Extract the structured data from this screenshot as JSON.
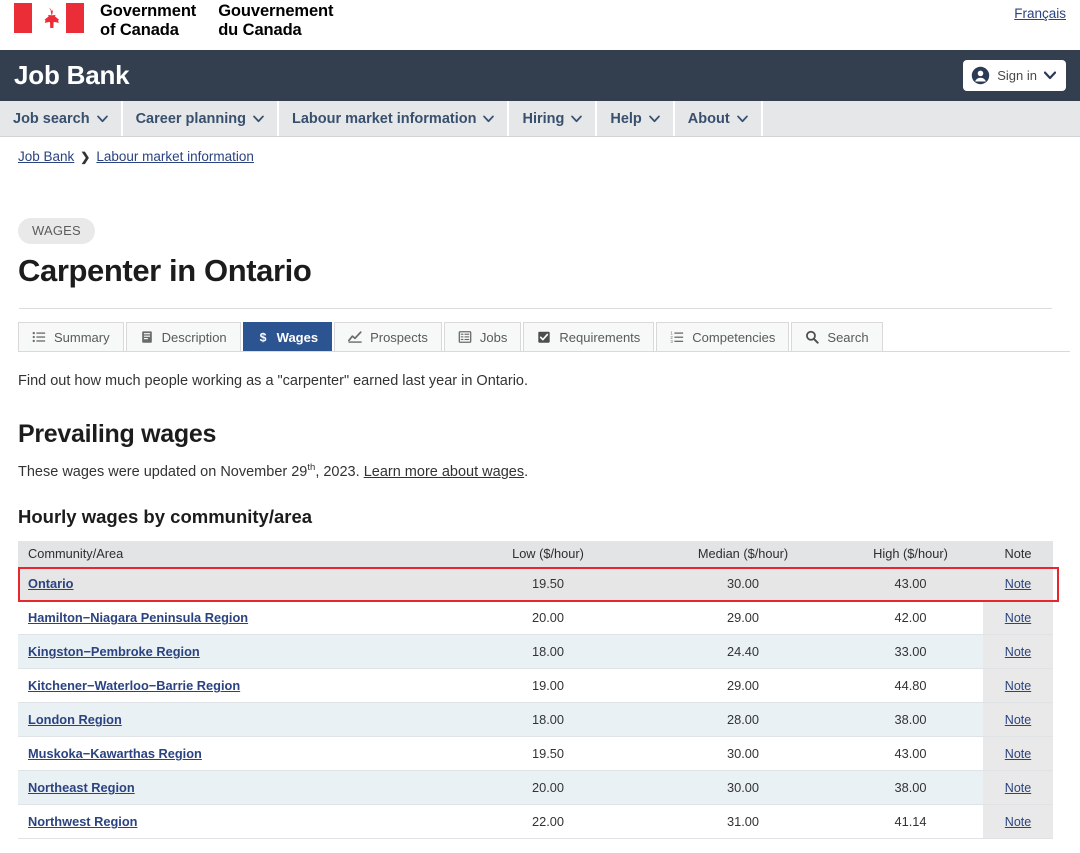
{
  "goc_header": {
    "flag_alt": "canada-flag",
    "wordmark_en_line1": "Government",
    "wordmark_en_line2": "of Canada",
    "wordmark_fr_line1": "Gouvernement",
    "wordmark_fr_line2": "du Canada",
    "language_toggle": "Français"
  },
  "app_bar": {
    "title": "Job Bank",
    "signin_label": "Sign in"
  },
  "main_nav": {
    "items": [
      {
        "label": "Job search",
        "has_caret": true
      },
      {
        "label": "Career planning",
        "has_caret": true
      },
      {
        "label": "Labour market information",
        "has_caret": true
      },
      {
        "label": "Hiring",
        "has_caret": true
      },
      {
        "label": "Help",
        "has_caret": true
      },
      {
        "label": "About",
        "has_caret": true
      }
    ]
  },
  "breadcrumb": {
    "items": [
      "Job Bank",
      "Labour market information"
    ],
    "separator": "❯"
  },
  "page": {
    "badge": "WAGES",
    "title": "Carpenter in Ontario",
    "intro": "Find out how much people working as a \"carpenter\" earned last year in Ontario.",
    "section_heading": "Prevailing wages",
    "updated_prefix": "These wages were updated on November 29",
    "updated_sup": "th",
    "updated_suffix": ", 2023. ",
    "updated_link": "Learn more about wages",
    "updated_period": ".",
    "subsection_heading": "Hourly wages by community/area"
  },
  "tabs": [
    {
      "label": "Summary",
      "icon": "list-icon",
      "active": false
    },
    {
      "label": "Description",
      "icon": "book-icon",
      "active": false
    },
    {
      "label": "Wages",
      "icon": "dollar-icon",
      "active": true
    },
    {
      "label": "Prospects",
      "icon": "chart-line-icon",
      "active": false
    },
    {
      "label": "Jobs",
      "icon": "table-icon",
      "active": false
    },
    {
      "label": "Requirements",
      "icon": "checkbox-icon",
      "active": false
    },
    {
      "label": "Competencies",
      "icon": "ordered-list-icon",
      "active": false
    },
    {
      "label": "Search",
      "icon": "search-icon",
      "active": false
    }
  ],
  "wages_table": {
    "columns": [
      "Community/Area",
      "Low ($/hour)",
      "Median ($/hour)",
      "High ($/hour)",
      "Note"
    ],
    "note_label": "Note",
    "rows": [
      {
        "area": "Ontario",
        "low": "19.50",
        "median": "30.00",
        "high": "43.00",
        "note": "Note",
        "highlighted": true
      },
      {
        "area": "Hamilton−Niagara Peninsula Region",
        "low": "20.00",
        "median": "29.00",
        "high": "42.00",
        "note": "Note",
        "highlighted": false
      },
      {
        "area": "Kingston−Pembroke Region",
        "low": "18.00",
        "median": "24.40",
        "high": "33.00",
        "note": "Note",
        "highlighted": false
      },
      {
        "area": "Kitchener−Waterloo−Barrie Region",
        "low": "19.00",
        "median": "29.00",
        "high": "44.80",
        "note": "Note",
        "highlighted": false
      },
      {
        "area": "London Region",
        "low": "18.00",
        "median": "28.00",
        "high": "38.00",
        "note": "Note",
        "highlighted": false
      },
      {
        "area": "Muskoka−Kawarthas Region",
        "low": "19.50",
        "median": "30.00",
        "high": "43.00",
        "note": "Note",
        "highlighted": false
      },
      {
        "area": "Northeast Region",
        "low": "20.00",
        "median": "30.00",
        "high": "38.00",
        "note": "Note",
        "highlighted": false
      },
      {
        "area": "Northwest Region",
        "low": "22.00",
        "median": "31.00",
        "high": "41.14",
        "note": "Note",
        "highlighted": false
      }
    ]
  },
  "colors": {
    "app_bar_bg": "#333f4f",
    "nav_bg": "#e5e7e9",
    "nav_text": "#38506e",
    "link": "#2b4380",
    "active_tab_bg": "#2c5491",
    "highlight_border": "#e8262d",
    "row_alt_bg": "#eaf1f5",
    "note_col_bg": "#e9e9e9",
    "flag_red": "#ea2d37"
  }
}
